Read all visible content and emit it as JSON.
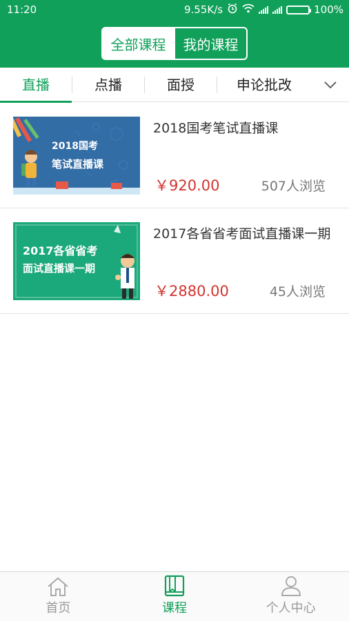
{
  "status": {
    "time": "11:20",
    "speed": "9.55K/s",
    "battery": "100%"
  },
  "header": {
    "seg_all": "全部课程",
    "seg_mine": "我的课程"
  },
  "tabs": [
    {
      "label": "直播"
    },
    {
      "label": "点播"
    },
    {
      "label": "面授"
    },
    {
      "label": "申论批改"
    }
  ],
  "courses": [
    {
      "thumb_year": "2018国考",
      "thumb_line2": "笔试直播课",
      "title": "2018国考笔试直播课",
      "price": "￥920.00",
      "views": "507人浏览"
    },
    {
      "thumb_line1": "2017各省省考",
      "thumb_line2": "面试直播课一期",
      "title": "2017各省省考面试直播课一期",
      "price": "￥2880.00",
      "views": "45人浏览"
    }
  ],
  "bottom_nav": [
    {
      "label": "首页",
      "icon": "home-icon"
    },
    {
      "label": "课程",
      "icon": "book-icon"
    },
    {
      "label": "个人中心",
      "icon": "user-icon"
    }
  ],
  "colors": {
    "brand": "#11a05a",
    "price": "#d2332e"
  }
}
